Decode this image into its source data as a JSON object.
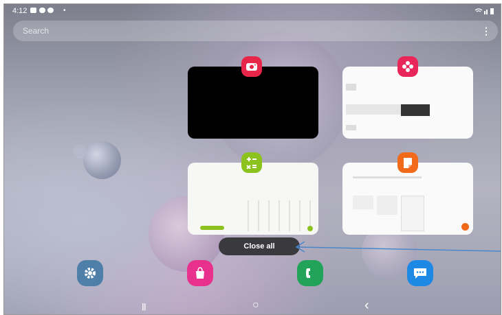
{
  "status_bar": {
    "time": "4:12"
  },
  "search": {
    "placeholder": "Search",
    "menu_glyph": "⋮"
  },
  "recents": {
    "cards": [
      {
        "name": "camera",
        "accent": "#e8264a",
        "icon": "camera-icon"
      },
      {
        "name": "gallery",
        "accent": "#e8265a",
        "icon": "flower-icon"
      },
      {
        "name": "calculator",
        "accent": "#8bc21e",
        "icon": "calculator-icon"
      },
      {
        "name": "notes",
        "accent": "#f06a1a",
        "icon": "notes-icon"
      }
    ],
    "close_all_label": "Close all"
  },
  "dock": [
    {
      "name": "settings",
      "color": "#4e7fa8",
      "icon": "gear-icon"
    },
    {
      "name": "store",
      "color": "#e8318c",
      "icon": "shopping-bag-icon"
    },
    {
      "name": "phone",
      "color": "#21a35a",
      "icon": "phone-icon"
    },
    {
      "name": "messages",
      "color": "#1e88e5",
      "icon": "chat-icon"
    }
  ],
  "nav": {
    "recents_glyph": "|||",
    "home_glyph": "○",
    "back_glyph": "‹"
  }
}
